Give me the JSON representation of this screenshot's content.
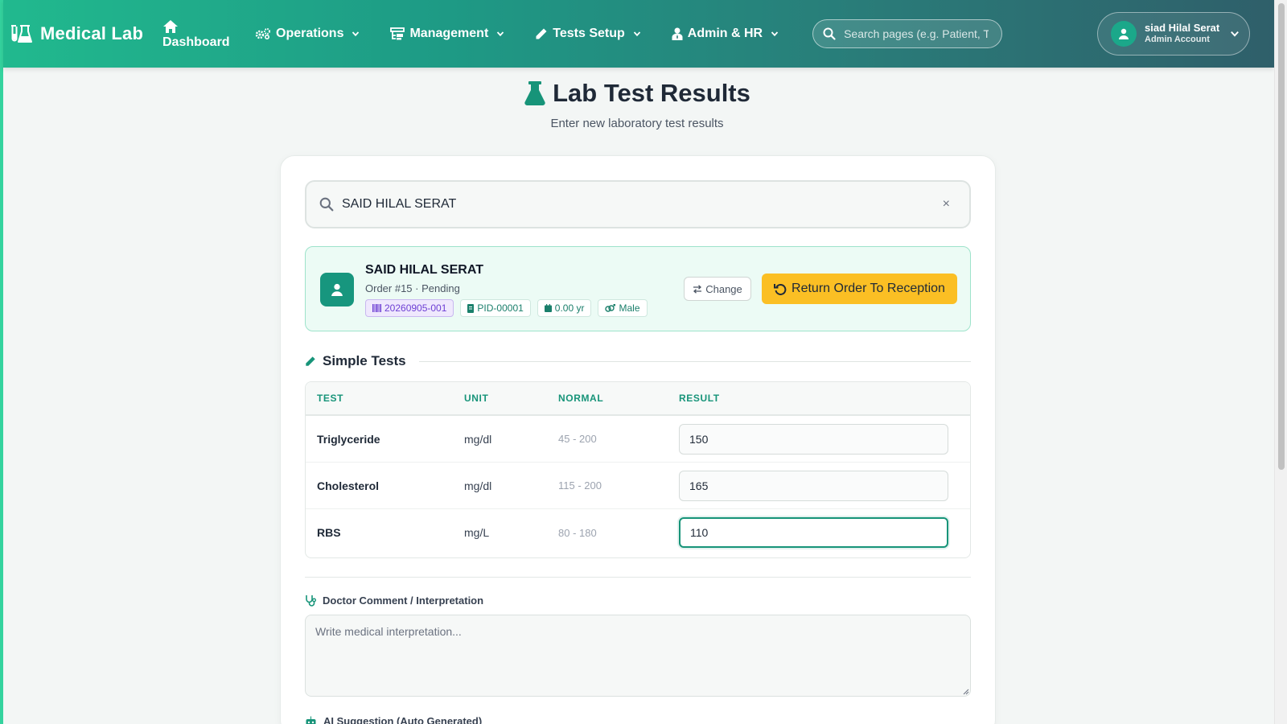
{
  "navbar": {
    "brand": "Medical Lab",
    "dashboard": "Dashboard",
    "menus": [
      {
        "label": "Operations"
      },
      {
        "label": "Management"
      },
      {
        "label": "Tests Setup"
      },
      {
        "label": "Admin & HR"
      }
    ],
    "search_placeholder": "Search pages (e.g. Patient, T",
    "user_name": "siad Hilal Serat",
    "user_role": "Admin Account"
  },
  "header": {
    "title": "Lab Test Results",
    "subtitle": "Enter new laboratory test results"
  },
  "patient_search": {
    "value": "SAID HILAL SERAT",
    "clear": "×"
  },
  "patient": {
    "name": "SAID HILAL SERAT",
    "order": "Order #15 · Pending",
    "barcode": "20260905-001",
    "pid": "PID-00001",
    "age": "0.00 yr",
    "gender": "Male",
    "change_label": "Change",
    "return_label": "Return Order To Reception"
  },
  "simple_tests": {
    "title": "Simple Tests",
    "columns": [
      "TEST",
      "UNIT",
      "NORMAL",
      "RESULT"
    ],
    "rows": [
      {
        "test": "Triglyceride",
        "unit": "mg/dl",
        "normal": "45 - 200",
        "result": "150"
      },
      {
        "test": "Cholesterol",
        "unit": "mg/dl",
        "normal": "115 - 200",
        "result": "165"
      },
      {
        "test": "RBS",
        "unit": "mg/L",
        "normal": "80 - 180",
        "result": "110"
      }
    ]
  },
  "comment": {
    "label": "Doctor Comment / Interpretation",
    "placeholder": "Write medical interpretation..."
  },
  "ai": {
    "label": "AI Suggestion (Auto Generated)"
  },
  "colors": {
    "primary": "#179479",
    "warning": "#fbbf24",
    "accent_purple": "#6d3fd4"
  }
}
